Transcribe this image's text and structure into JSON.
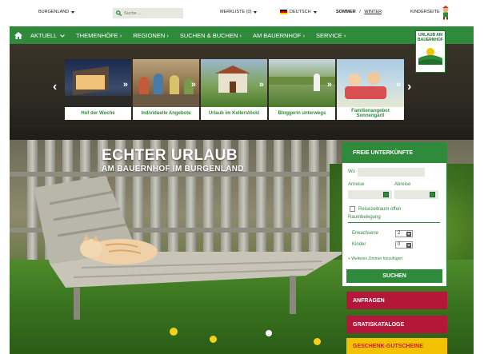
{
  "topbar": {
    "region": "BURGENLAND",
    "search_placeholder": "Suche ...",
    "merkliste": "MERKLISTE (0)",
    "language": "DEUTSCH",
    "season_summer": "SOMMER",
    "season_sep": " / ",
    "season_winter": "WINTER",
    "kids": "KINDERSEITE"
  },
  "nav": {
    "items": [
      {
        "label": "AKTUELL"
      },
      {
        "label": "THEMENHÖFE ›"
      },
      {
        "label": "REGIONEN ›"
      },
      {
        "label": "SUCHEN & BUCHEN ›"
      },
      {
        "label": "AM BAUERNHOF ›"
      },
      {
        "label": "SERVICE ›"
      }
    ]
  },
  "logo": {
    "line1": "URLAUB AM",
    "line2": "BAUERNHOF"
  },
  "carousel": {
    "prev": "‹",
    "next": "›",
    "slides": [
      {
        "caption": "Hof der Woche"
      },
      {
        "caption": "Individuelle Angebote"
      },
      {
        "caption": "Urlaub im Kellerstöckl"
      },
      {
        "caption": "Bloggerin unterwegs"
      },
      {
        "caption": "Familienangebot Sonnengartl"
      }
    ]
  },
  "hero": {
    "headline": "ECHTER URLAUB",
    "subline": "AM BAUERNHOF IM BURGENLAND"
  },
  "booking": {
    "title": "FREIE UNTERKÜNFTE",
    "wo_label": "Wo",
    "anreise_label": "Anreise",
    "abreise_label": "Abreise",
    "reisezeitraum_label": "Reisezeitraum offen",
    "raumbelegung_label": "Raumbelegung",
    "erwachsene_label": "Erwachsene",
    "erwachsene_value": "2",
    "kinder_label": "Kinder",
    "kinder_value": "0",
    "more_rooms": "+ Weiteres Zimmer hinzufügen",
    "search_button": "SUCHEN"
  },
  "cta": {
    "anfragen": "ANFRAGEN",
    "kataloge": "GRATISKATALOGE",
    "gutscheine": "GESCHENK-GUTSCHEINE"
  },
  "colors": {
    "green": "#2f8a3c",
    "red": "#b5173b",
    "yellow": "#f2c200",
    "gutschein_text": "#d2182c"
  }
}
